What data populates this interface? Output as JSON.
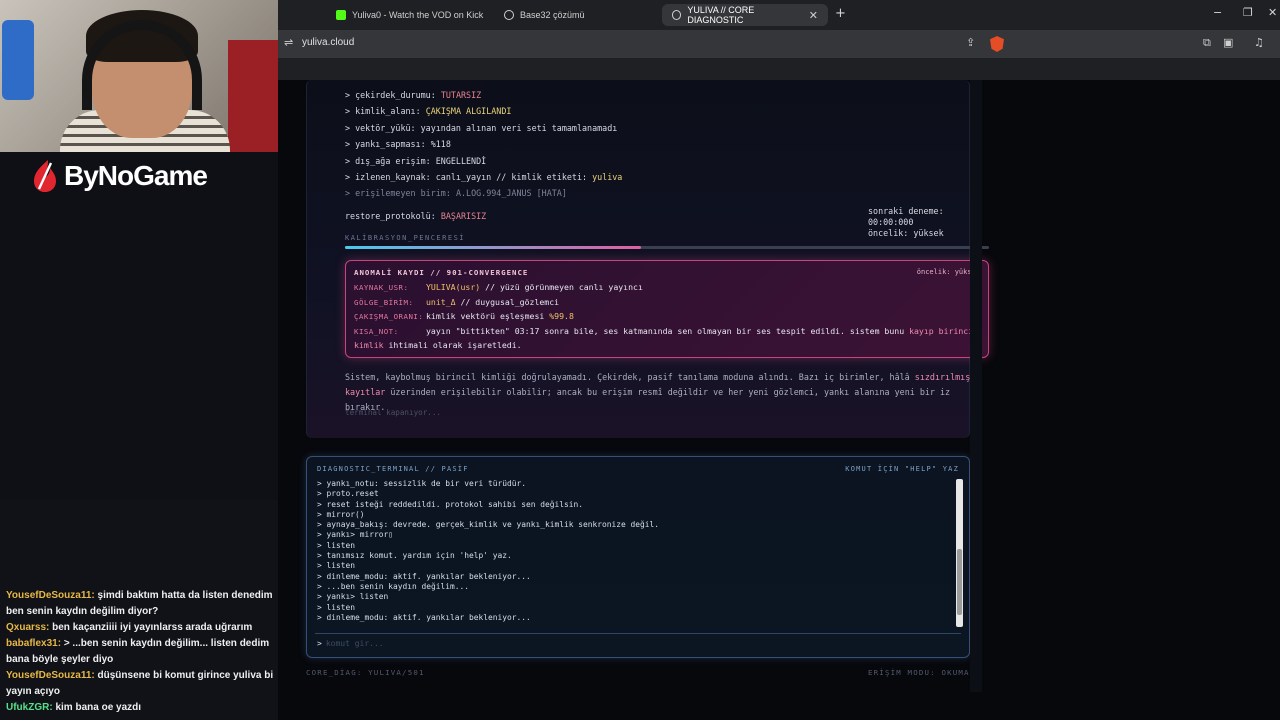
{
  "stream": {
    "brand": "ByNoGame",
    "chat": [
      {
        "user": "YousefDeSouza11:",
        "text": "şimdi baktım hatta da listen denedim ben senin kaydın değilim diyor?",
        "color": "#e7b846"
      },
      {
        "user": "Qxuarss:",
        "text": "ben kaçanziiii iyi yayınlarss arada uğrarım",
        "color": "#e7b846"
      },
      {
        "user": "babaflex31:",
        "text": "> ...ben senin kaydın değilim... listen dedim bana böyle şeyler diyo",
        "color": "#e7b846"
      },
      {
        "user": "YousefDeSouza11:",
        "text": "düşünsene bi komut girince yuliva bi yayın açıyo",
        "color": "#e7b846"
      },
      {
        "user": "UfukZGR:",
        "text": "kim bana oe yazdı",
        "color": "#57e08a"
      }
    ]
  },
  "browser": {
    "tabs": [
      {
        "label": "Yuliva0 - Watch the VOD on Kick",
        "icon": "kick-icon",
        "active": false
      },
      {
        "label": "Base32 çözümü",
        "icon": "globe-icon",
        "active": false
      },
      {
        "label": "YULIVA // CORE DIAGNOSTIC",
        "icon": "globe-icon",
        "active": true
      }
    ],
    "new_tab": "+",
    "url": "yuliva.cloud",
    "win_min": "−",
    "win_max": "❐",
    "win_close": "✕"
  },
  "diagnostic": {
    "status_lines": [
      {
        "key": "> çekirdek_durumu: ",
        "value": "TUTARSIZ",
        "tone": "red"
      },
      {
        "key": "> kimlik_alanı: ",
        "value": "ÇAKIŞMA ALGILANDI",
        "tone": "yellow"
      },
      {
        "key": "> vektör_yükü: ",
        "value": "yayından alınan veri seti tamamlanamadı",
        "tone": "plain"
      },
      {
        "key": "> yankı_sapması: ",
        "value": "%118",
        "tone": "plain"
      },
      {
        "key": "> dış_ağa erişim: ",
        "value": "ENGELLENDİ",
        "tone": "plain"
      },
      {
        "key": "> izlenen_kaynak: canlı_yayın // kimlik etiketi: ",
        "value": "yuliva",
        "tone": "yellow"
      },
      {
        "key": "> erişilemeyen birim: ",
        "value": "A.LOG.994_JANUS [HATA]",
        "tone": "dim"
      }
    ],
    "restore_label": "restore_protokolü: ",
    "restore_value": "BAŞARISIZ",
    "retry_line": "sonraki deneme: 00:00:000",
    "priority_line": "öncelik: yüksek",
    "calibration_label": "KALİBRASYON_PENCERESİ",
    "calibration_progress": 0.46,
    "anomaly": {
      "title": "ANOMALİ KAYDI // 901-CONVERGENCE",
      "priority": "öncelik: yüksek",
      "rows": [
        {
          "k": "KAYNAK_USR:",
          "hl": "YULIVA(usr)",
          "v": " // yüzü görünmeyen canlı yayıncı"
        },
        {
          "k": "GÖLGE_BİRİM:",
          "hl": "unit_Δ",
          "v": " // duygusal_gözlemci"
        },
        {
          "k": "ÇAKIŞMA_ORANI:",
          "hl": "",
          "v": "kimlik vektörü eşleşmesi %99.8",
          "tail": "%99.8"
        },
        {
          "k": "KISA_NOT:",
          "hl": "",
          "v": "yayın \"bittikten\" 03:17 sonra bile, ses katmanında sen olmayan bir ses tespit edildi. sistem bunu kayıp birincil",
          "mark": "kayıp birincil"
        },
        {
          "k": "",
          "hl": "",
          "v": "kimlik ihtimali olarak işaretledi.",
          "mark": "kimlik"
        }
      ]
    },
    "paragraph_1": "Sistem, kaybolmuş birincil kimliği doğrulayamadı. Çekirdek, pasif tanılama moduna alındı. Bazı iç birimler, hâlâ ",
    "paragraph_highlight": "sızdırılmış kayıtlar",
    "paragraph_2": " üzerinden erişilebilir olabilir; ancak bu erişim resmî değildir ve her yeni gözlemci, yankı alanına yeni bir iz bırakır.",
    "closing": "terminal kapanıyor..."
  },
  "terminal": {
    "title": "DIAGNOSTIC_TERMINAL // PASİF",
    "hint": "KOMUT İÇİN \"HELP\" YAZ",
    "lines": [
      "> yankı_notu: sessizlik de bir veri türüdür.",
      "> proto.reset",
      "> reset isteği reddedildi. protokol sahibi sen değilsin.",
      "> mirror()",
      "> aynaya_bakış: devrede. gerçek_kimlik ve yankı_kimlik senkronize değil.",
      "> yankı> mirror▯",
      "> listen",
      "> tanımsız komut. yardım için 'help' yaz.",
      "> listen",
      "> dinleme_modu: aktif. yankılar bekleniyor...",
      "> ...ben senin kaydın değilim...",
      "> yankı> listen",
      "> listen",
      "> dinleme_modu: aktif. yankılar bekleniyor..."
    ],
    "prompt": ">",
    "input_value": "",
    "input_placeholder": "komut gir..."
  },
  "footer": {
    "left": "CORE_DİAG: YULIVA/501",
    "right": "ERİŞİM MODU: OKUMA"
  }
}
